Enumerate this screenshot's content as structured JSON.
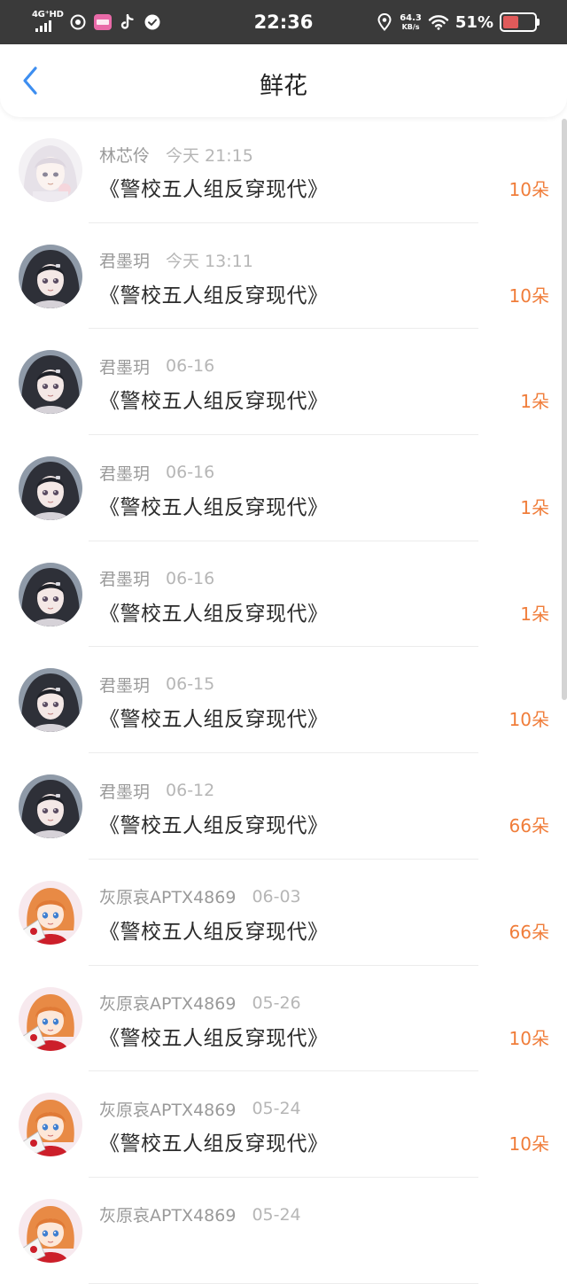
{
  "status_bar": {
    "network": "4G⁺HD",
    "time": "22:36",
    "net_speed_value": "64.3",
    "net_speed_unit": "KB/s",
    "battery": "51%",
    "battery_level": 0.51,
    "icons": [
      "signal-icon",
      "compass-icon",
      "app-icon",
      "tiktok-icon",
      "check-icon",
      "location-icon",
      "wifi-icon",
      "battery-icon"
    ]
  },
  "header": {
    "back_icon": "chevron-left-icon",
    "title": "鲜花"
  },
  "colors": {
    "accent": "#3d8ef0",
    "flower_count": "#f07d3a",
    "name": "#9a9a9a",
    "time": "#b6b6b6",
    "status_bar_bg": "#3a3a3a"
  },
  "records": [
    {
      "avatar": "white-hair-girl",
      "name": "林芯伶",
      "time": "今天 21:15",
      "book": "《警校五人组反穿现代》",
      "count": "10朵"
    },
    {
      "avatar": "dark-hair-girl",
      "name": "君墨玥",
      "time": "今天 13:11",
      "book": "《警校五人组反穿现代》",
      "count": "10朵"
    },
    {
      "avatar": "dark-hair-girl",
      "name": "君墨玥",
      "time": "06-16",
      "book": "《警校五人组反穿现代》",
      "count": "1朵"
    },
    {
      "avatar": "dark-hair-girl",
      "name": "君墨玥",
      "time": "06-16",
      "book": "《警校五人组反穿现代》",
      "count": "1朵"
    },
    {
      "avatar": "dark-hair-girl",
      "name": "君墨玥",
      "time": "06-16",
      "book": "《警校五人组反穿现代》",
      "count": "1朵"
    },
    {
      "avatar": "dark-hair-girl",
      "name": "君墨玥",
      "time": "06-15",
      "book": "《警校五人组反穿现代》",
      "count": "10朵"
    },
    {
      "avatar": "dark-hair-girl",
      "name": "君墨玥",
      "time": "06-12",
      "book": "《警校五人组反穿现代》",
      "count": "66朵"
    },
    {
      "avatar": "orange-hair-girl",
      "name": "灰原哀APTX4869",
      "time": "06-03",
      "book": "《警校五人组反穿现代》",
      "count": "66朵"
    },
    {
      "avatar": "orange-hair-girl",
      "name": "灰原哀APTX4869",
      "time": "05-26",
      "book": "《警校五人组反穿现代》",
      "count": "10朵"
    },
    {
      "avatar": "orange-hair-girl",
      "name": "灰原哀APTX4869",
      "time": "05-24",
      "book": "《警校五人组反穿现代》",
      "count": "10朵"
    },
    {
      "avatar": "orange-hair-girl",
      "name": "灰原哀APTX4869",
      "time": "05-24",
      "book": "",
      "count": ""
    }
  ]
}
